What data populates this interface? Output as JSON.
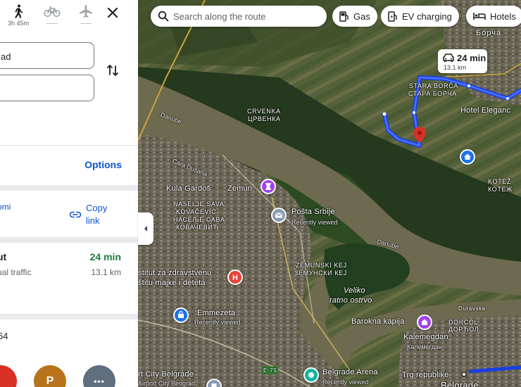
{
  "modes": {
    "walk": {
      "time": "3h 45m"
    },
    "bike": {
      "time": ""
    },
    "flight": {
      "time": ""
    }
  },
  "inputs": {
    "origin_value": "ad",
    "destination_value": ""
  },
  "options_label": "Options",
  "share": {
    "left_label": "omi",
    "copy_link_label": "Copy link"
  },
  "route": {
    "name": "ut",
    "traffic": "ual traffic",
    "time": "24 min",
    "distance": "13.1 km"
  },
  "bottom_number": "64",
  "categories": [
    {
      "icon": "parking-icon",
      "letter": "P",
      "color": "#b8741a"
    },
    {
      "icon": "more-icon",
      "letter": "•••",
      "color": "#5f6f80"
    }
  ],
  "map": {
    "search_placeholder": "Search along the route",
    "chips": {
      "gas": "Gas",
      "ev": "EV charging",
      "hotels": "Hotels"
    },
    "route_card": {
      "time": "24 min",
      "distance": "13.1 km"
    },
    "labels": {
      "borca": "Борча",
      "stara_borca_lat": "STARA BORČA",
      "stara_borca_cyr": "СТАРА БОРЧА",
      "hotel": "Hotel Eleganc",
      "crvenka_lat": "CRVENKA",
      "crvenka_cyr": "ЦРВЕНКА",
      "danube1": "Danube",
      "danube2": "Danube",
      "cara_dusana": "Cara Dušana",
      "kula": "Kula Gardoš",
      "zemun": "Zemun",
      "posta": "Pošta Srbije",
      "recent1": "Recently viewed",
      "naselje1": "NASELJE SAVA",
      "naselje2": "KOVAČEVIĆ",
      "naselje3": "НАСЕЉЕ САВА",
      "naselje4": "КОВАЧЕВИЋ",
      "kotez1": "KOTEŽ",
      "kotez2": "КОТЕЖ",
      "zemunski1": "ZEMUNSKI KEJ",
      "zemunski2": "ЗЕМУНСКИ КЕЈ",
      "institut1": "stitut za zdravstvenu",
      "institut2": "štitu majke i deteta",
      "veliko1": "Veliko",
      "veliko2": "ratno ostrvo",
      "emmezeta": "Emmezeta",
      "recent2": "Recently viewed",
      "barokna": "Barokna kapija",
      "durav": "Duravska",
      "dorcol1": "DORĆOL",
      "dorcol2": "ДОРЋОЛ",
      "kalem1": "Kalemegdan",
      "kalem2": "Калемегдан",
      "city_belgrade": "rt City Belgrade",
      "airport_city": "Airport City Beograd",
      "arena": "Belgrade Arena",
      "arena_sub": "Recently viewed",
      "trg": "Trg republike",
      "belgrade": "Belgrade",
      "e75": "E-75"
    }
  }
}
